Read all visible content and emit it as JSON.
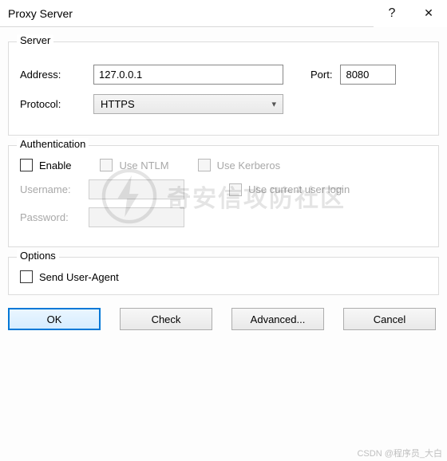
{
  "window": {
    "title": "Proxy Server",
    "help_glyph": "?",
    "close_glyph": "✕"
  },
  "groups": {
    "server": {
      "title": "Server",
      "address_label": "Address:",
      "address_value": "127.0.0.1",
      "port_label": "Port:",
      "port_value": "8080",
      "protocol_label": "Protocol:",
      "protocol_value": "HTTPS"
    },
    "auth": {
      "title": "Authentication",
      "enable_label": "Enable",
      "ntlm_label": "Use NTLM",
      "kerberos_label": "Use Kerberos",
      "username_label": "Username:",
      "password_label": "Password:",
      "current_user_label": "Use current user login"
    },
    "options": {
      "title": "Options",
      "send_ua_label": "Send User-Agent"
    }
  },
  "buttons": {
    "ok": "OK",
    "check": "Check",
    "advanced": "Advanced...",
    "cancel": "Cancel"
  },
  "watermark": {
    "text": "奇安信攻防社区",
    "credit": "CSDN @程序员_大白"
  }
}
